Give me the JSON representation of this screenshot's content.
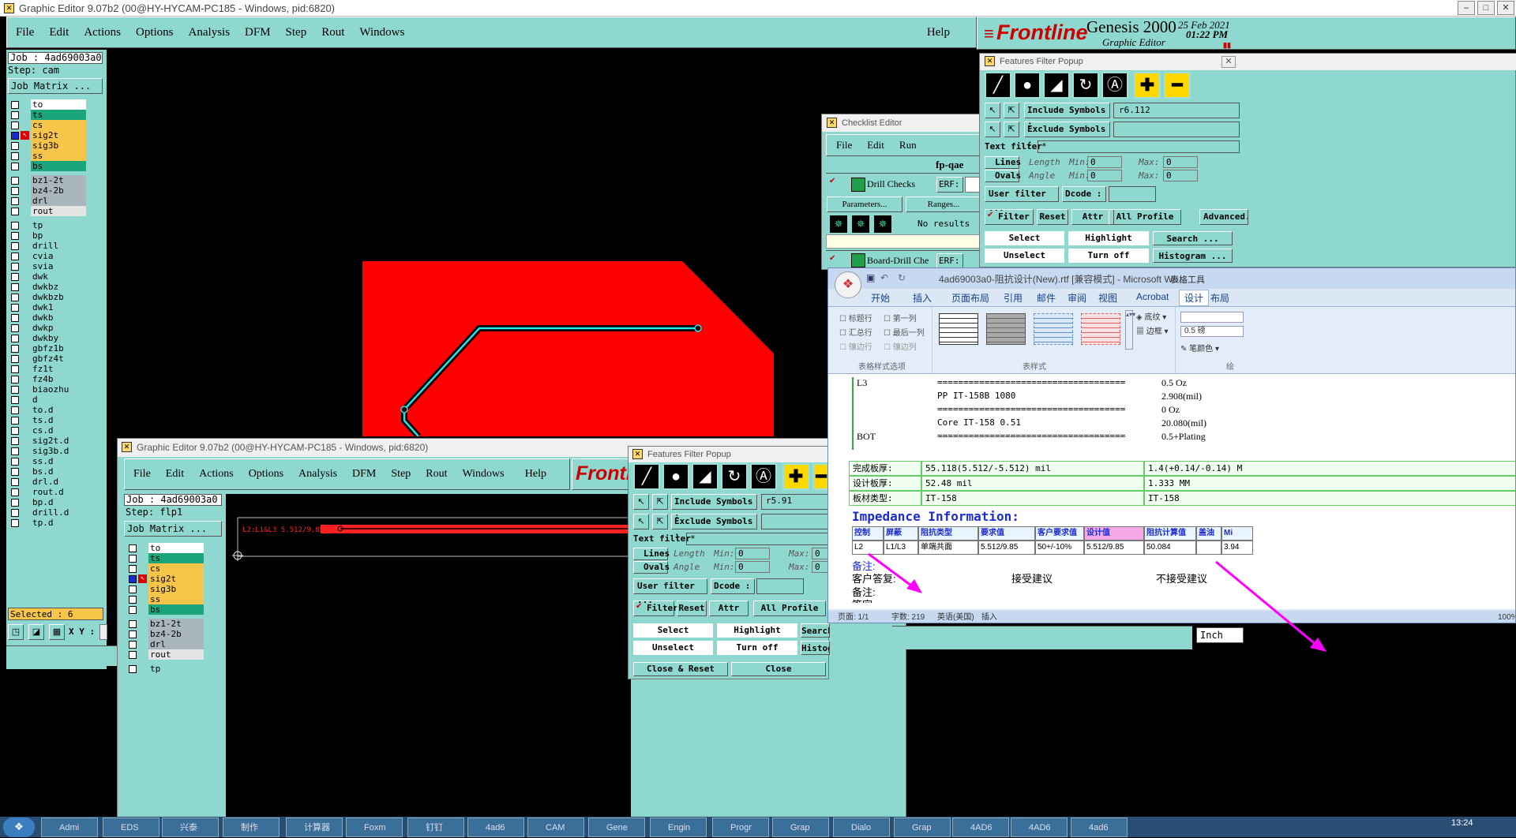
{
  "main_window": {
    "title": "Graphic Editor 9.07b2 (00@HY-HYCAM-PC185 - Windows, pid:6820)",
    "menu": [
      "File",
      "Edit",
      "Actions",
      "Options",
      "Analysis",
      "DFM",
      "Step",
      "Rout",
      "Windows"
    ],
    "help": "Help"
  },
  "brand": {
    "logo": "Frontline",
    "product": "Genesis 2000",
    "subtitle": "Graphic Editor",
    "date": "25 Feb 2021",
    "time": "01:22 PM"
  },
  "job": {
    "job_label": "Job : 4ad69003a0",
    "step_label": "Step: cam",
    "matrix_button": "Job Matrix ..."
  },
  "layers": [
    {
      "name": "to",
      "color": "#ffffff"
    },
    {
      "name": "ts",
      "color": "#1aa57a"
    },
    {
      "name": "cs",
      "color": "#f6c54a"
    },
    {
      "name": "sig2t",
      "color": "#f6c54a"
    },
    {
      "name": "sig3b",
      "color": "#f6c54a"
    },
    {
      "name": "ss",
      "color": "#f6c54a"
    },
    {
      "name": "bs",
      "color": "#1aa57a"
    },
    {
      "name": "bz1-2t",
      "color": "#a9b6be"
    },
    {
      "name": "bz4-2b",
      "color": "#a9b6be"
    },
    {
      "name": "drl",
      "color": "#a9b6be"
    },
    {
      "name": "rout",
      "color": "#e4e4e4"
    },
    {
      "name": "tp",
      "color": "#8fd8d0"
    },
    {
      "name": "bp",
      "color": "#8fd8d0"
    },
    {
      "name": "drill",
      "color": "#8fd8d0"
    },
    {
      "name": "cvia",
      "color": "#8fd8d0"
    },
    {
      "name": "svia",
      "color": "#8fd8d0"
    },
    {
      "name": "dwk",
      "color": "#8fd8d0"
    },
    {
      "name": "dwkbz",
      "color": "#8fd8d0"
    },
    {
      "name": "dwkbzb",
      "color": "#8fd8d0"
    },
    {
      "name": "dwk1",
      "color": "#8fd8d0"
    },
    {
      "name": "dwkb",
      "color": "#8fd8d0"
    },
    {
      "name": "dwkp",
      "color": "#8fd8d0"
    },
    {
      "name": "dwkby",
      "color": "#8fd8d0"
    },
    {
      "name": "gbfz1b",
      "color": "#8fd8d0"
    },
    {
      "name": "gbfz4t",
      "color": "#8fd8d0"
    },
    {
      "name": "fz1t",
      "color": "#8fd8d0"
    },
    {
      "name": "fz4b",
      "color": "#8fd8d0"
    },
    {
      "name": "biaozhu",
      "color": "#8fd8d0"
    },
    {
      "name": "d",
      "color": "#8fd8d0"
    },
    {
      "name": "to.d",
      "color": "#8fd8d0"
    },
    {
      "name": "ts.d",
      "color": "#8fd8d0"
    },
    {
      "name": "cs.d",
      "color": "#8fd8d0"
    },
    {
      "name": "sig2t.d",
      "color": "#8fd8d0"
    },
    {
      "name": "sig3b.d",
      "color": "#8fd8d0"
    },
    {
      "name": "ss.d",
      "color": "#8fd8d0"
    },
    {
      "name": "bs.d",
      "color": "#8fd8d0"
    },
    {
      "name": "drl.d",
      "color": "#8fd8d0"
    },
    {
      "name": "rout.d",
      "color": "#8fd8d0"
    },
    {
      "name": "bp.d",
      "color": "#8fd8d0"
    },
    {
      "name": "drill.d",
      "color": "#8fd8d0"
    },
    {
      "name": "tp.d",
      "color": "#8fd8d0"
    }
  ],
  "selected": "Selected : 6",
  "xy_label": "X Y :",
  "checklist": {
    "title": "Checklist Editor",
    "menu": [
      "File",
      "Edit",
      "Run"
    ],
    "name": "fp-qae",
    "checks": [
      {
        "label": "Drill Checks",
        "erf": "ERF:",
        "param": "Parameters...",
        "ranges": "Ranges...",
        "status": "No results"
      },
      {
        "label": "Board-Drill Che",
        "erf": "ERF:"
      }
    ]
  },
  "ff_main": {
    "title": "Features Filter Popup",
    "include_label": "Include Symbols :",
    "include_value": "r6.112",
    "exclude_label": "Exclude Symbols :",
    "exclude_value": "",
    "text_filter_label": "Text filter",
    "text_filter_value": "*",
    "lines": "Lines",
    "ovals": "Ovals",
    "length": "Length",
    "angle": "Angle",
    "min": "Min:",
    "max": "Max:",
    "zero": "0",
    "user_filter": "User filter ...",
    "dcode": "Dcode :",
    "filter": "Filter",
    "reset": "Reset",
    "attr": "Attr ...",
    "profile": "All Profile",
    "advanced": "Advanced...",
    "select": "Select",
    "highlight": "Highlight",
    "search": "Search ...",
    "unselect": "Unselect",
    "turn_off": "Turn off",
    "histogram": "Histogram ..."
  },
  "ff_second": {
    "title": "Features Filter Popup",
    "include_value": "r5.91",
    "close_reset": "Close & Reset",
    "close": "Close"
  },
  "second_window": {
    "title": "Graphic Editor 9.07b2 (00@HY-HYCAM-PC185 - Windows, pid:6820)",
    "job_label": "Job : 4ad69003a0",
    "step_label": "Step: flp1",
    "matrix_button": "Job Matrix ...",
    "trace_text": "L2:L1&L3 5.512/9.85",
    "layers": [
      {
        "name": "to",
        "color": "#ffffff"
      },
      {
        "name": "ts",
        "color": "#1aa57a"
      },
      {
        "name": "cs",
        "color": "#f6c54a"
      },
      {
        "name": "sig2t",
        "color": "#f6c54a"
      },
      {
        "name": "sig3b",
        "color": "#f6c54a"
      },
      {
        "name": "ss",
        "color": "#f6c54a"
      },
      {
        "name": "bs",
        "color": "#1aa57a"
      },
      {
        "name": "bz1-2t",
        "color": "#a9b6be"
      },
      {
        "name": "bz4-2b",
        "color": "#a9b6be"
      },
      {
        "name": "drl",
        "color": "#a9b6be"
      },
      {
        "name": "rout",
        "color": "#e4e4e4"
      },
      {
        "name": "tp",
        "color": "#8fd8d0"
      }
    ]
  },
  "word": {
    "title": "4ad69003a0-阻抗设计(New).rtf [兼容模式] - Microsoft Wo...",
    "table_tools": "表格工具",
    "tabs": [
      "开始",
      "插入",
      "页面布局",
      "引用",
      "邮件",
      "审阅",
      "视图",
      "Acrobat",
      "设计",
      "布局"
    ],
    "checks": [
      "标题行",
      "第一列",
      "汇总行",
      "最后一列",
      "镶边行",
      "镶边列"
    ],
    "group1": "表格样式选项",
    "group2": "表样式",
    "shading": "底纹",
    "border": "边框",
    "line_weight": "0.5 磅",
    "pen_color": "笔颜色",
    "draw": "绘",
    "stack": [
      {
        "l": "L3",
        "d": "====================================",
        "v": "0.5 Oz"
      },
      {
        "l": "",
        "d": "PP    IT-158B    1080",
        "v": "2.908(mil)"
      },
      {
        "l": "",
        "d": "====================================",
        "v": "0 Oz"
      },
      {
        "l": "",
        "d": "Core    IT-158    0.51",
        "v": "20.080(mil)"
      },
      {
        "l": "BOT",
        "d": "====================================",
        "v": "0.5+Plating"
      }
    ],
    "board": [
      {
        "k": "完成板厚:",
        "v": "55.118(5.512/-5.512) mil",
        "r": "1.4(+0.14/-0.14) M"
      },
      {
        "k": "设计板厚:",
        "v": "52.48 mil",
        "r": "1.333 MM"
      },
      {
        "k": "板材类型:",
        "v": "IT-158",
        "r": "IT-158"
      }
    ],
    "imp_title": "Impedance Information:",
    "imp_headers": [
      "控制",
      "屏蔽",
      "阻抗类型",
      "要求值",
      "客户要求值",
      "设计值",
      "阻抗计算值",
      "盖油",
      "Mi"
    ],
    "imp_row": [
      "L2",
      "L1/L3",
      "单端共面",
      "5.512/9.85",
      "50+/-10%",
      "5.512/9.85",
      "50.084",
      "",
      "3.94"
    ],
    "note1": "备注:",
    "reply": "客户答复:",
    "accept": "接受建议",
    "reject": "不接受建议",
    "note2": "备注:",
    "note3": "签字",
    "status": [
      "页面: 1/1",
      "字数: 219",
      "英语(美国)",
      "插入"
    ],
    "zoom": "100%"
  },
  "inch": "Inch",
  "taskbar": {
    "items": [
      "Admi",
      "EDS",
      "兴泰",
      "制作",
      "计算器",
      "Foxm",
      "钉钉",
      "4ad6",
      "CAM",
      "Gene",
      "Engin",
      "Progr",
      "Grap",
      "Dialo",
      "Grap",
      "4AD6",
      "4AD6",
      "4ad6"
    ],
    "clock": "13:24"
  }
}
